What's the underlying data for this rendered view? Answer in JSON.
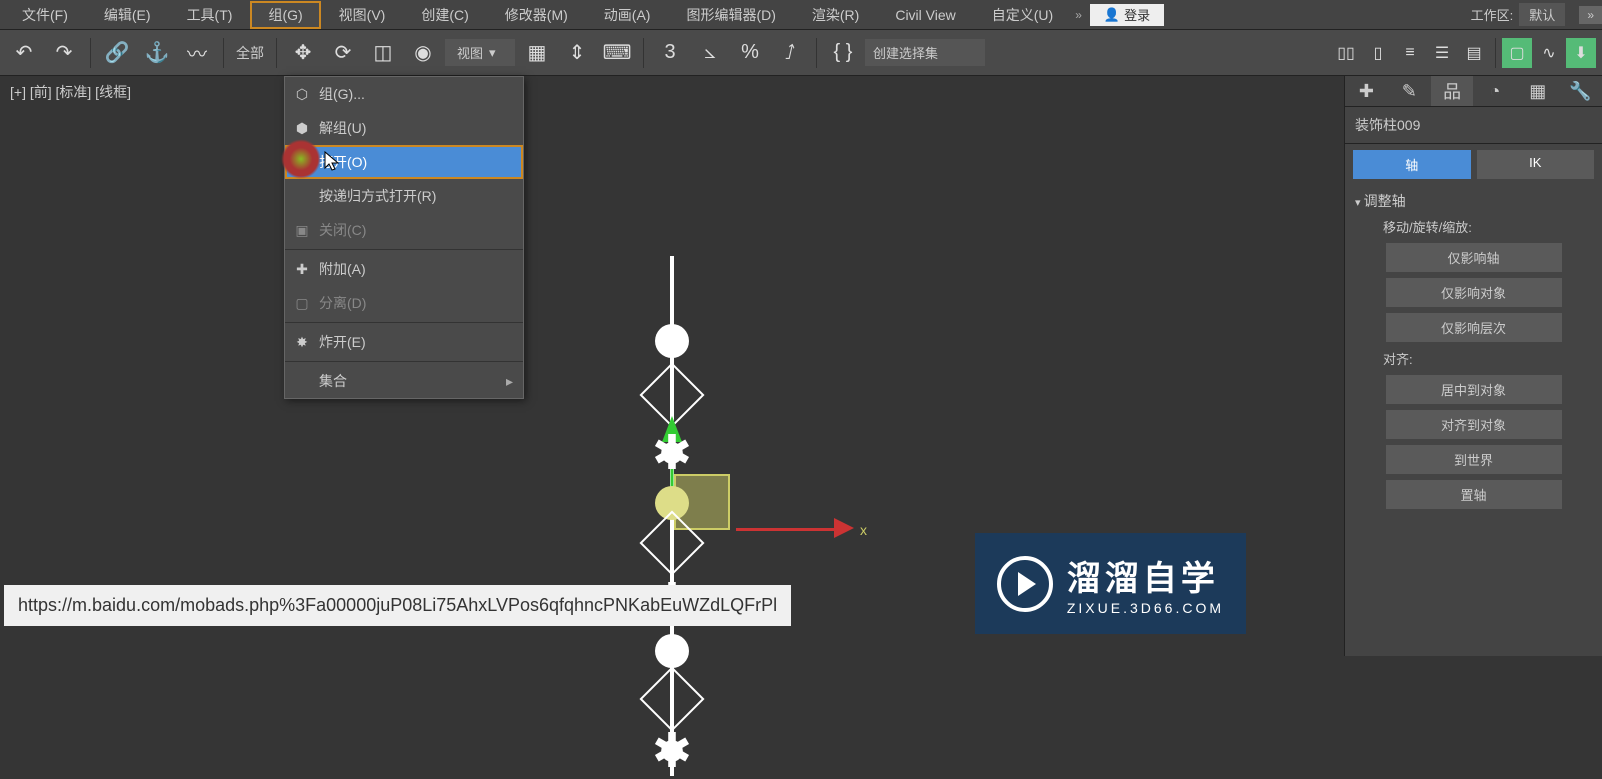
{
  "menu": {
    "items": [
      "文件(F)",
      "编辑(E)",
      "工具(T)",
      "组(G)",
      "视图(V)",
      "创建(C)",
      "修改器(M)",
      "动画(A)",
      "图形编辑器(D)",
      "渲染(R)",
      "Civil View",
      "自定义(U)"
    ],
    "open_index": 3,
    "login": "登录",
    "workspace_label": "工作区:",
    "workspace_value": "默认",
    "expand": "»"
  },
  "dropdown": {
    "items": [
      {
        "label": "组(G)...",
        "enabled": true
      },
      {
        "label": "解组(U)",
        "enabled": true
      },
      {
        "label": "打开(O)",
        "enabled": true,
        "highlight": true
      },
      {
        "label": "按递归方式打开(R)",
        "enabled": true
      },
      {
        "label": "关闭(C)",
        "enabled": false
      },
      {
        "sep": true
      },
      {
        "label": "附加(A)",
        "enabled": true
      },
      {
        "label": "分离(D)",
        "enabled": false
      },
      {
        "sep": true
      },
      {
        "label": "炸开(E)",
        "enabled": true
      },
      {
        "sep": true
      },
      {
        "label": "集合",
        "enabled": true,
        "submenu": true
      }
    ]
  },
  "toolbar": {
    "all_label": "全部",
    "view_label": "视图",
    "selset_placeholder": "创建选择集"
  },
  "viewport": {
    "label": "[+] [前] [标准] [线框]",
    "axis_x": "x"
  },
  "side": {
    "object_name": "装饰柱009",
    "tab_axis": "轴",
    "tab_ik": "IK",
    "section_adjust": "调整轴",
    "sub_move": "移动/旋转/缩放:",
    "btn_axis_only": "仅影响轴",
    "btn_obj_only": "仅影响对象",
    "btn_hier_only": "仅影响层次",
    "sub_align": "对齐:",
    "btn_center_obj": "居中到对象",
    "btn_align_obj": "对齐到对象",
    "btn_to_world": "到世界",
    "btn_reset_axis": "置轴"
  },
  "watermark": {
    "title": "溜溜自学",
    "sub": "ZIXUE.3D66.COM"
  },
  "url": "https://m.baidu.com/mobads.php%3Fa00000juP08Li75AhxLVPos6qfqhncPNKabEuWZdLQFrPl"
}
